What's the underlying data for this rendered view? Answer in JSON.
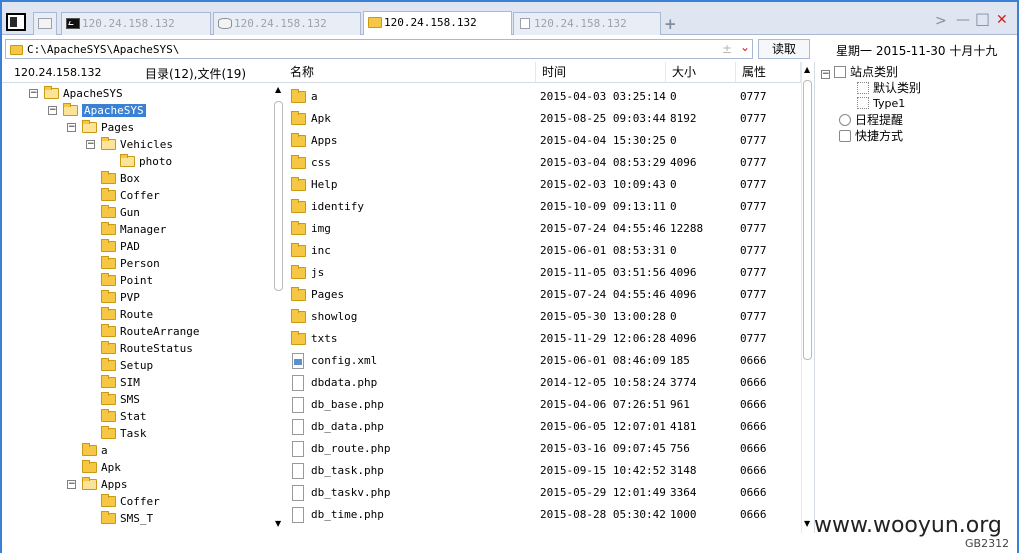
{
  "tabs": [
    {
      "label": "",
      "icon": "blank-tab-icon",
      "active": false
    },
    {
      "label": "120.24.158.132",
      "icon": "terminal-icon",
      "active": false
    },
    {
      "label": "120.24.158.132",
      "icon": "database-icon",
      "active": false
    },
    {
      "label": "120.24.158.132",
      "icon": "folder-icon",
      "active": true
    },
    {
      "label": "120.24.158.132",
      "icon": "file-icon",
      "active": false
    }
  ],
  "tab_add": "+",
  "window": {
    "next": ">",
    "minimize": "—",
    "maximize": "□",
    "close": "✕",
    "close_color": "#d32020"
  },
  "address": {
    "path": "C:\\ApacheSYS\\ApacheSYS\\",
    "plusminus": "±",
    "dropdown": "⌄",
    "read_button": "读取"
  },
  "date": "星期一  2015-11-30  十月十九",
  "left": {
    "host": "120.24.158.132",
    "dircount": "目录(12),文件(19)"
  },
  "tree": [
    {
      "label": "ApacheSYS",
      "depth": 0,
      "expander": "⊟",
      "open": true
    },
    {
      "label": "ApacheSYS",
      "depth": 1,
      "expander": "⊟",
      "open": true,
      "selected": true
    },
    {
      "label": "Pages",
      "depth": 2,
      "expander": "⊟",
      "open": true
    },
    {
      "label": "Vehicles",
      "depth": 3,
      "expander": "⊟",
      "open": true
    },
    {
      "label": "photo",
      "depth": 4,
      "open": true
    },
    {
      "label": "Box",
      "depth": 3
    },
    {
      "label": "Coffer",
      "depth": 3
    },
    {
      "label": "Gun",
      "depth": 3
    },
    {
      "label": "Manager",
      "depth": 3
    },
    {
      "label": "PAD",
      "depth": 3
    },
    {
      "label": "Person",
      "depth": 3
    },
    {
      "label": "Point",
      "depth": 3
    },
    {
      "label": "PVP",
      "depth": 3
    },
    {
      "label": "Route",
      "depth": 3
    },
    {
      "label": "RouteArrange",
      "depth": 3
    },
    {
      "label": "RouteStatus",
      "depth": 3
    },
    {
      "label": "Setup",
      "depth": 3
    },
    {
      "label": "SIM",
      "depth": 3
    },
    {
      "label": "SMS",
      "depth": 3
    },
    {
      "label": "Stat",
      "depth": 3
    },
    {
      "label": "Task",
      "depth": 3
    },
    {
      "label": "a",
      "depth": 2
    },
    {
      "label": "Apk",
      "depth": 2
    },
    {
      "label": "Apps",
      "depth": 2,
      "expander": "⊟",
      "open": true
    },
    {
      "label": "Coffer",
      "depth": 3
    },
    {
      "label": "SMS_T",
      "depth": 3
    }
  ],
  "columns": {
    "name": "名称",
    "time": "时间",
    "size": "大小",
    "attr": "属性"
  },
  "files": [
    {
      "type": "folder",
      "name": "a",
      "time": "2015-04-03 03:25:14",
      "size": "0",
      "attr": "0777"
    },
    {
      "type": "folder",
      "name": "Apk",
      "time": "2015-08-25 09:03:44",
      "size": "8192",
      "attr": "0777"
    },
    {
      "type": "folder",
      "name": "Apps",
      "time": "2015-04-04 15:30:25",
      "size": "0",
      "attr": "0777"
    },
    {
      "type": "folder",
      "name": "css",
      "time": "2015-03-04 08:53:29",
      "size": "4096",
      "attr": "0777"
    },
    {
      "type": "folder",
      "name": "Help",
      "time": "2015-02-03 10:09:43",
      "size": "0",
      "attr": "0777"
    },
    {
      "type": "folder",
      "name": "identify",
      "time": "2015-10-09 09:13:11",
      "size": "0",
      "attr": "0777"
    },
    {
      "type": "folder",
      "name": "img",
      "time": "2015-07-24 04:55:46",
      "size": "12288",
      "attr": "0777"
    },
    {
      "type": "folder",
      "name": "inc",
      "time": "2015-06-01 08:53:31",
      "size": "0",
      "attr": "0777"
    },
    {
      "type": "folder",
      "name": "js",
      "time": "2015-11-05 03:51:56",
      "size": "4096",
      "attr": "0777"
    },
    {
      "type": "folder",
      "name": "Pages",
      "time": "2015-07-24 04:55:46",
      "size": "4096",
      "attr": "0777"
    },
    {
      "type": "folder",
      "name": "showlog",
      "time": "2015-05-30 13:00:28",
      "size": "0",
      "attr": "0777"
    },
    {
      "type": "folder",
      "name": "txts",
      "time": "2015-11-29 12:06:28",
      "size": "4096",
      "attr": "0777"
    },
    {
      "type": "xml",
      "name": "config.xml",
      "time": "2015-06-01 08:46:09",
      "size": "185",
      "attr": "0666"
    },
    {
      "type": "doc",
      "name": "dbdata.php",
      "time": "2014-12-05 10:58:24",
      "size": "3774",
      "attr": "0666"
    },
    {
      "type": "doc",
      "name": "db_base.php",
      "time": "2015-04-06 07:26:51",
      "size": "961",
      "attr": "0666"
    },
    {
      "type": "doc",
      "name": "db_data.php",
      "time": "2015-06-05 12:07:01",
      "size": "4181",
      "attr": "0666"
    },
    {
      "type": "doc",
      "name": "db_route.php",
      "time": "2015-03-16 09:07:45",
      "size": "756",
      "attr": "0666"
    },
    {
      "type": "doc",
      "name": "db_task.php",
      "time": "2015-09-15 10:42:52",
      "size": "3148",
      "attr": "0666"
    },
    {
      "type": "doc",
      "name": "db_taskv.php",
      "time": "2015-05-29 12:01:49",
      "size": "3364",
      "attr": "0666"
    },
    {
      "type": "doc",
      "name": "db_time.php",
      "time": "2015-08-28 05:30:42",
      "size": "1000",
      "attr": "0666"
    }
  ],
  "right": {
    "site_category": "站点类别",
    "default_category": "默认类别",
    "type1": "Type1",
    "schedule": "日程提醒",
    "shortcuts": "快捷方式"
  },
  "watermark": "www.wooyun.org",
  "encoding": "GB2312",
  "scroll_up": "▲",
  "scroll_down": "▼"
}
